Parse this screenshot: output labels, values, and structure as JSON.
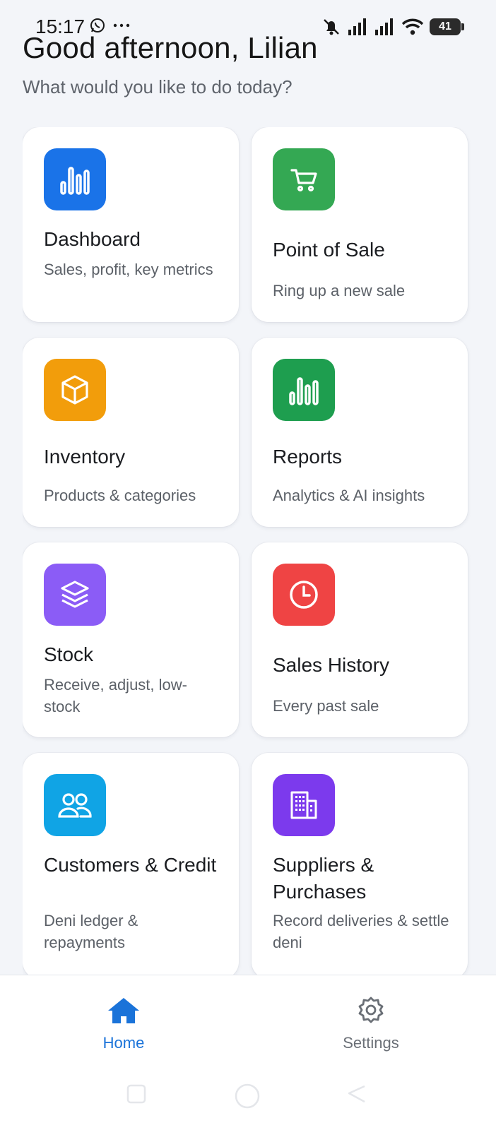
{
  "status": {
    "time": "15:17",
    "battery": "41"
  },
  "header": {
    "greeting": "Good afternoon, Lilian",
    "subtitle": "What would you like to do today?"
  },
  "cards": [
    {
      "title": "Dashboard",
      "desc": "Sales, profit, key metrics",
      "icon": "bar-chart-icon",
      "color": "#1a73e8"
    },
    {
      "title": "Point of Sale",
      "desc": "Ring up a new sale",
      "icon": "cart-icon",
      "color": "#34a853"
    },
    {
      "title": "Inventory",
      "desc": "Products & categories",
      "icon": "box-icon",
      "color": "#f29d0b"
    },
    {
      "title": "Reports",
      "desc": "Analytics & AI insights",
      "icon": "bar-chart-icon",
      "color": "#1e9e4f"
    },
    {
      "title": "Stock",
      "desc": "Receive, adjust, low-stock",
      "icon": "layers-icon",
      "color": "#8b5cf6"
    },
    {
      "title": "Sales History",
      "desc": "Every past sale",
      "icon": "clock-icon",
      "color": "#ef4444"
    },
    {
      "title": "Customers & Credit",
      "desc": "Deni ledger & repayments",
      "icon": "users-icon",
      "color": "#10a4e5"
    },
    {
      "title": "Suppliers & Purchases",
      "desc": "Record deliveries & settle deni",
      "icon": "building-icon",
      "color": "#7c3aed"
    }
  ],
  "nav": {
    "home": "Home",
    "settings": "Settings"
  }
}
